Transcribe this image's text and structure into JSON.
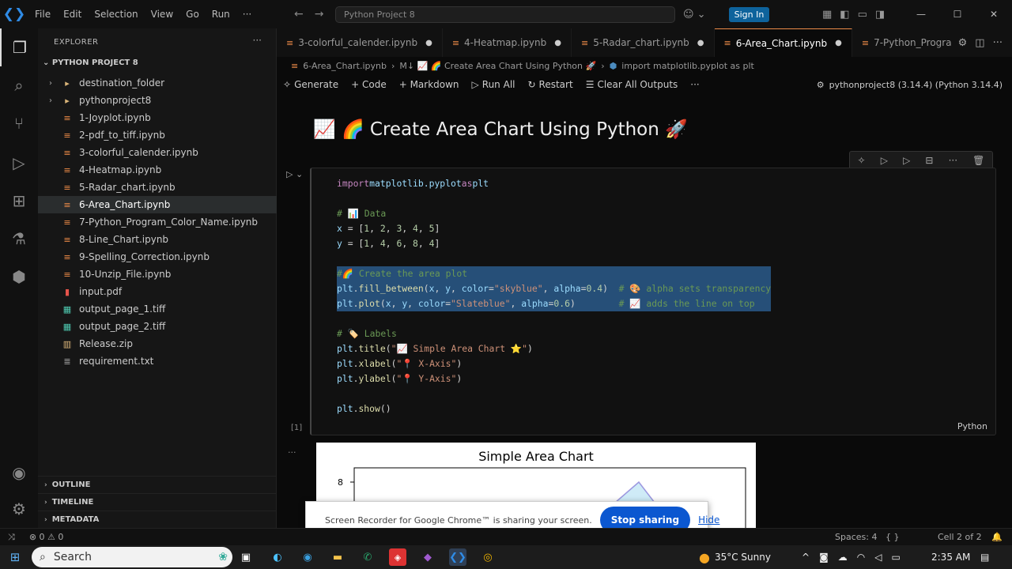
{
  "title": {
    "menu": [
      "File",
      "Edit",
      "Selection",
      "View",
      "Go",
      "Run",
      "···"
    ],
    "search": "Python Project 8",
    "signin": "Sign In"
  },
  "explorer": {
    "title": "EXPLORER",
    "project": "PYTHON PROJECT 8",
    "items": [
      {
        "label": "destination_folder",
        "type": "folder"
      },
      {
        "label": "pythonproject8",
        "type": "folder"
      },
      {
        "label": "1-Joyplot.ipynb",
        "type": "nb"
      },
      {
        "label": "2-pdf_to_tiff.ipynb",
        "type": "nb"
      },
      {
        "label": "3-colorful_calender.ipynb",
        "type": "nb"
      },
      {
        "label": "4-Heatmap.ipynb",
        "type": "nb"
      },
      {
        "label": "5-Radar_chart.ipynb",
        "type": "nb"
      },
      {
        "label": "6-Area_Chart.ipynb",
        "type": "nb"
      },
      {
        "label": "7-Python_Program_Color_Name.ipynb",
        "type": "nb"
      },
      {
        "label": "8-Line_Chart.ipynb",
        "type": "nb"
      },
      {
        "label": "9-Spelling_Correction.ipynb",
        "type": "nb"
      },
      {
        "label": "10-Unzip_File.ipynb",
        "type": "nb"
      },
      {
        "label": "input.pdf",
        "type": "pdf"
      },
      {
        "label": "output_page_1.tiff",
        "type": "tif"
      },
      {
        "label": "output_page_2.tiff",
        "type": "tif"
      },
      {
        "label": "Release.zip",
        "type": "zip"
      },
      {
        "label": "requirement.txt",
        "type": "txt"
      }
    ],
    "sections": [
      "OUTLINE",
      "TIMELINE",
      "METADATA"
    ]
  },
  "tabs": [
    {
      "label": "3-colorful_calender.ipynb",
      "active": false
    },
    {
      "label": "4-Heatmap.ipynb",
      "active": false
    },
    {
      "label": "5-Radar_chart.ipynb",
      "active": false
    },
    {
      "label": "6-Area_Chart.ipynb",
      "active": true
    },
    {
      "label": "7-Python_Progra",
      "active": false
    }
  ],
  "breadcrumb": {
    "file": "6-Area_Chart.ipynb",
    "md": "M↓ 📈 🌈 Create Area Chart Using Python 🚀",
    "cell": "import matplotlib.pyplot as plt"
  },
  "toolbar": {
    "generate": "Generate",
    "code": "+ Code",
    "markdown": "+ Markdown",
    "runall": "Run All",
    "restart": "Restart",
    "clear": "Clear All Outputs",
    "more": "···",
    "kernel": "pythonproject8 (3.14.4) (Python 3.14.4)"
  },
  "markdown_heading": "📈 🌈 Create Area Chart Using Python 🚀",
  "cell": {
    "exec": "[1]",
    "language": "Python",
    "lines": [
      "import matplotlib.pyplot as plt",
      "",
      "# 📊 Data",
      "x = [1, 2, 3, 4, 5]",
      "y = [1, 4, 6, 8, 4]",
      "",
      "#🌈 Create the area plot",
      "plt.fill_between(x, y, color=\"skyblue\", alpha=0.4)  # 🎨 alpha sets transparency",
      "plt.plot(x, y, color=\"Slateblue\", alpha=0.6)        # 📈 adds the line on top",
      "",
      "# 🏷️ Labels",
      "plt.title(\"📈 Simple Area Chart ⭐\")",
      "plt.xlabel(\"📍 X-Axis\")",
      "plt.ylabel(\"📍 Y-Axis\")",
      "",
      "plt.show()"
    ]
  },
  "output": {
    "title": "Simple Area Chart",
    "ytick": "8"
  },
  "toast": {
    "message": "Screen Recorder for Google Chrome™ is sharing your screen.",
    "stop": "Stop sharing",
    "hide": "Hide"
  },
  "status": {
    "errors": "⊗ 0 ⚠ 0",
    "spaces": "Spaces: 4",
    "cell": "Cell 2 of 2"
  },
  "taskbar": {
    "search": "Search",
    "weather": "35°C Sunny",
    "time": "2:35 AM"
  }
}
